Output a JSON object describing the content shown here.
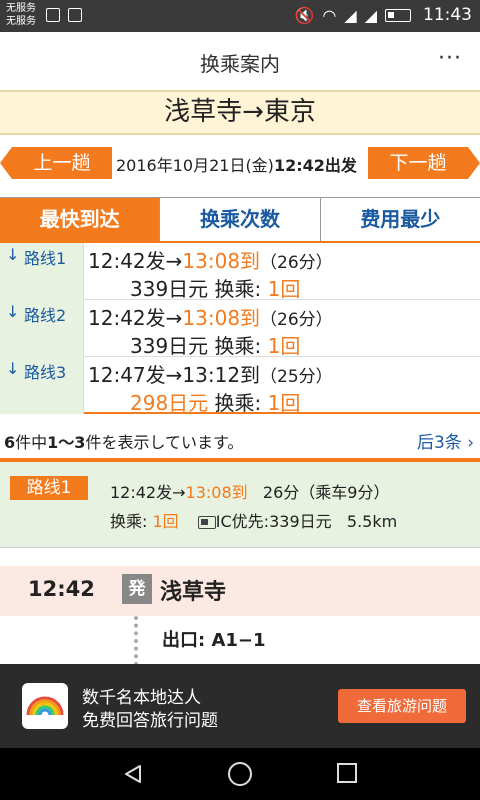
{
  "status_bar": {
    "carrier_1": "无服务",
    "carrier_2": "无服务",
    "time": "11:43"
  },
  "header": {
    "title": "换乘案内",
    "more": "···"
  },
  "route": {
    "title": "浅草寺→東京"
  },
  "date_nav": {
    "prev_label": "上一趟",
    "next_label": "下一趟",
    "date": "2016年10月21日(金)",
    "time": "12:42出发"
  },
  "tabs": [
    {
      "label": "最快到达",
      "active": true
    },
    {
      "label": "换乘次数",
      "active": false
    },
    {
      "label": "费用最少",
      "active": false
    }
  ],
  "routes": [
    {
      "name": "路线1",
      "arrow": "↓",
      "dep": "12:42发→",
      "arr": "13:08到",
      "dur": "（26分）",
      "fare": "339日元",
      "fare_highlight": false,
      "transfer_label": "换乘:",
      "transfers": "1回"
    },
    {
      "name": "路线2",
      "arrow": "↓",
      "dep": "12:42发→",
      "arr": "13:08到",
      "dur": "（26分）",
      "fare": "339日元",
      "fare_highlight": false,
      "transfer_label": "换乘:",
      "transfers": "1回"
    },
    {
      "name": "路线3",
      "arrow": "↓",
      "dep": "12:47发→",
      "arr": "13:12到",
      "dur": "（25分）",
      "fare": "298日元",
      "fare_highlight": true,
      "transfer_label": "换乘:",
      "transfers": "1回"
    }
  ],
  "results": {
    "total": "6",
    "mid1": "件中",
    "range": "1～3",
    "mid2": "件を表示しています。",
    "more_label": "后3条"
  },
  "detail": {
    "badge": "路线1",
    "dep": "12:42发→",
    "arr": "13:08到",
    "dur": "26分（乘车9分）",
    "transfer_label": "换乘:",
    "transfers": "1回",
    "ic_label": "IC优先:",
    "fare": "339日元",
    "distance": "5.5km"
  },
  "timeline": {
    "dep_time": "12:42",
    "dep_badge": "発",
    "dep_station": "浅草寺",
    "exit": "出口: A1−1"
  },
  "ad": {
    "line1": "数千名本地达人",
    "line2": "免费回答旅行问题",
    "button": "查看旅游问题"
  },
  "colors": {
    "accent": "#f37b1d",
    "link": "#1a5aa0",
    "route_bg": "#e8f2e0",
    "title_bg": "#fff5d6",
    "departure_bg": "#fce9e3"
  }
}
